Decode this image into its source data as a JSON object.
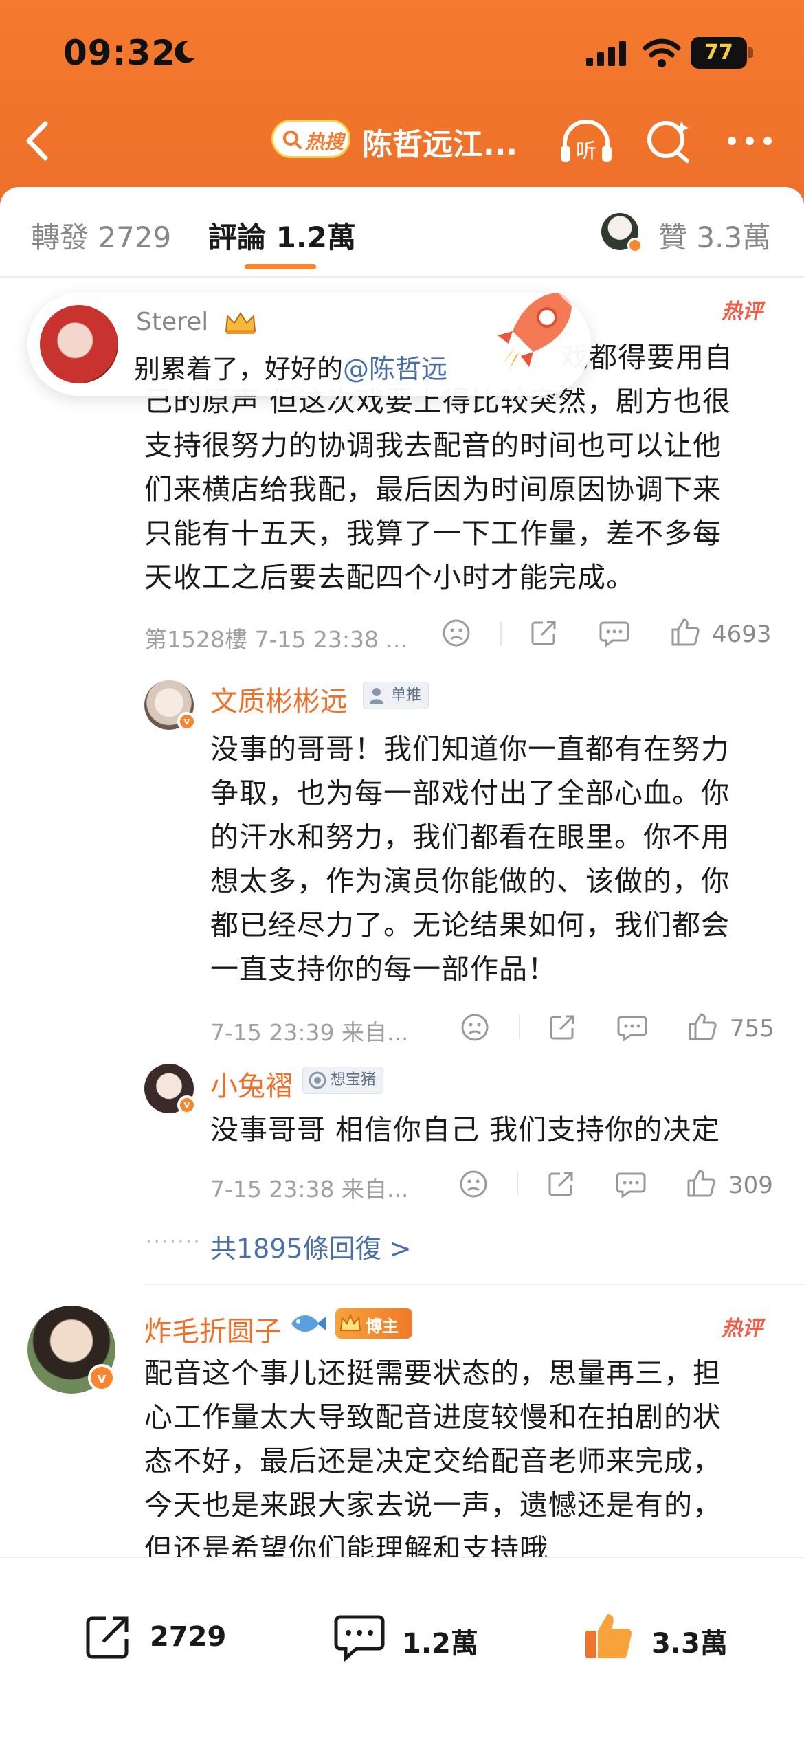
{
  "status_bar": {
    "time": "09:32",
    "battery": "77"
  },
  "nav": {
    "hot_badge": "热搜",
    "title": "陈哲远江...",
    "listen_label": "听"
  },
  "tabs": {
    "repost": "轉發 2729",
    "comment": "評論 1.2萬",
    "like": "贊 3.3萬"
  },
  "popup": {
    "name": "Sterel",
    "text": "别累着了，好好的",
    "mention": "@陈哲远"
  },
  "comments": [
    {
      "hot_tag": "热评",
      "lines": [
        "戏都得要用自",
        "己的原声 但这次戏要上得比较突然，剧方也很",
        "支持很努力的协调我去配音的时间也可以让他",
        "们来横店给我配，最后因为时间原因协调下来",
        "只能有十五天，我算了一下工作量，差不多每",
        "天收工之后要去配四个小时才能完成。"
      ],
      "meta": "第1528樓 7-15 23:38 ...",
      "likes": "4693",
      "replies": [
        {
          "name": "文质彬彬远",
          "tag": "单推",
          "lines": [
            "没事的哥哥！我们知道你一直都有在努力",
            "争取，也为每一部戏付出了全部心血。你",
            "的汗水和努力，我们都看在眼里。你不用",
            "想太多，作为演员你能做的、该做的，你",
            "都已经尽力了。无论结果如何，我们都会",
            "一直支持你的每一部作品！"
          ],
          "meta": "7-15 23:39 来自...",
          "likes": "755"
        },
        {
          "name": "小兔褶",
          "tag": "想宝猪",
          "lines": [
            "没事哥哥 相信你自己 我们支持你的决定"
          ],
          "meta": "7-15 23:38 来自...",
          "likes": "309"
        }
      ],
      "reply_more": "共1895條回復 >"
    },
    {
      "name": "炸毛折圆子",
      "tag": "博主",
      "hot_tag": "热评",
      "lines": [
        "配音这个事儿还挺需要状态的，思量再三，担",
        "心工作量太大导致配音进度较慢和在拍剧的状",
        "态不好，最后还是决定交给配音老师来完成，",
        "今天也是来跟大家去说一声，遗憾还是有的，",
        "但还是希望你们能理解和支持哦"
      ]
    }
  ],
  "bottom_bar": {
    "repost": "2729",
    "comment": "1.2萬",
    "like": "3.3萬"
  },
  "colors": {
    "brand": "#f47a2f",
    "accent_text": "#ee6f2a",
    "link": "#4a6fa8"
  }
}
